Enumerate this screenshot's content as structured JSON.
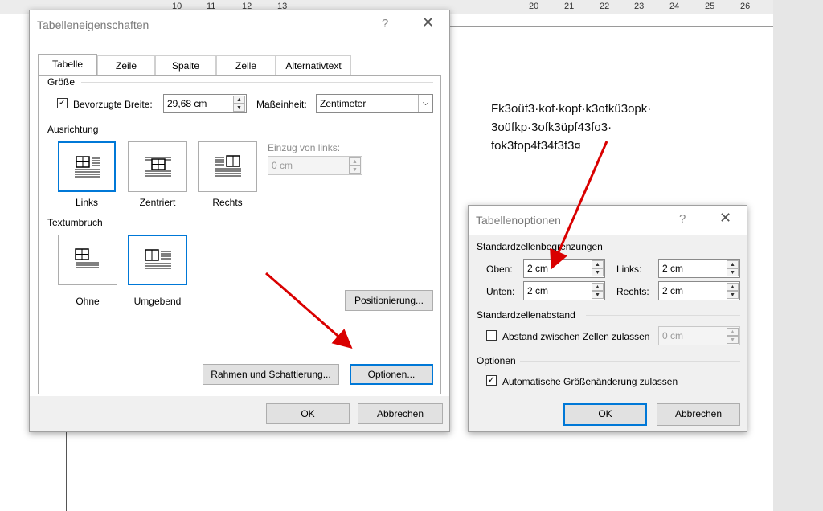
{
  "ruler": {
    "ticks": [
      "10",
      "11",
      "12",
      "13",
      "20",
      "21",
      "22",
      "23",
      "24",
      "25",
      "26"
    ]
  },
  "document": {
    "lines": [
      "Fk3oüf3·kof·kopf·k3ofkü3opk·",
      "3oüfkp·3ofk3üpf43fo3·",
      "fok3fop4f34f3f3¤"
    ]
  },
  "table_properties": {
    "title": "Tabelleneigenschaften",
    "help": "?",
    "close": "✕",
    "tabs": [
      "Tabelle",
      "Zeile",
      "Spalte",
      "Zelle",
      "Alternativtext"
    ],
    "size_group": "Größe",
    "preferred_width_label": "Bevorzugte Breite:",
    "preferred_width_checked": true,
    "preferred_width_value": "29,68 cm",
    "unit_label": "Maßeinheit:",
    "unit_value": "Zentimeter",
    "alignment_group": "Ausrichtung",
    "alignment_options": [
      "Links",
      "Zentriert",
      "Rechts"
    ],
    "indent_label": "Einzug von links:",
    "indent_value": "0 cm",
    "wrap_group": "Textumbruch",
    "wrap_options": [
      "Ohne",
      "Umgebend"
    ],
    "positioning_button": "Positionierung...",
    "borders_button": "Rahmen und Schattierung...",
    "options_button": "Optionen...",
    "ok": "OK",
    "cancel": "Abbrechen"
  },
  "table_options": {
    "title": "Tabellenoptionen",
    "help": "?",
    "close": "✕",
    "margins_group": "Standardzellenbegrenzungen",
    "top_label": "Oben:",
    "top_value": "2 cm",
    "left_label": "Links:",
    "left_value": "2 cm",
    "bottom_label": "Unten:",
    "bottom_value": "2 cm",
    "right_label": "Rechts:",
    "right_value": "2 cm",
    "spacing_group": "Standardzellenabstand",
    "spacing_label": "Abstand zwischen Zellen zulassen",
    "spacing_checked": false,
    "spacing_value": "0 cm",
    "options_group": "Optionen",
    "autoresize_label": "Automatische Größenänderung zulassen",
    "autoresize_checked": true,
    "ok": "OK",
    "cancel": "Abbrechen"
  },
  "colors": {
    "accent": "#0078d7",
    "arrow": "#d90000"
  }
}
